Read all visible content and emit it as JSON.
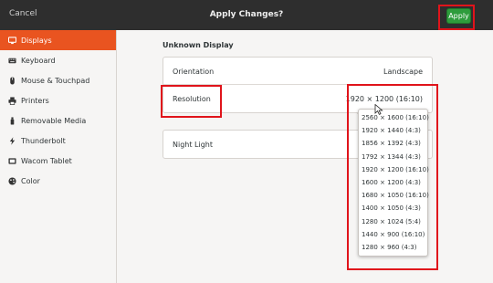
{
  "header": {
    "cancel_label": "Cancel",
    "title": "Apply Changes?",
    "apply_label": "Apply"
  },
  "sidebar": {
    "items": [
      {
        "label": "Displays",
        "icon": "display-icon",
        "active": true
      },
      {
        "label": "Keyboard",
        "icon": "keyboard-icon"
      },
      {
        "label": "Mouse & Touchpad",
        "icon": "mouse-icon"
      },
      {
        "label": "Printers",
        "icon": "printer-icon"
      },
      {
        "label": "Removable Media",
        "icon": "usb-drive-icon"
      },
      {
        "label": "Thunderbolt",
        "icon": "thunderbolt-icon"
      },
      {
        "label": "Wacom Tablet",
        "icon": "tablet-icon"
      },
      {
        "label": "Color",
        "icon": "color-palette-icon"
      }
    ]
  },
  "main": {
    "display_name": "Unknown Display",
    "orientation": {
      "label": "Orientation",
      "value": "Landscape"
    },
    "resolution": {
      "label": "Resolution",
      "value": "1920 × 1200 (16:10)"
    },
    "night_light": {
      "label": "Night Light"
    }
  },
  "resolution_options": [
    "2560 × 1600 (16:10)",
    "1920 × 1440 (4:3)",
    "1856 × 1392 (4:3)",
    "1792 × 1344 (4:3)",
    "1920 × 1200 (16:10)",
    "1600 × 1200 (4:3)",
    "1680 × 1050 (16:10)",
    "1400 × 1050 (4:3)",
    "1280 × 1024 (5:4)",
    "1440 × 900 (16:10)",
    "1280 × 960 (4:3)"
  ],
  "colors": {
    "header_bg": "#2e2e2e",
    "accent": "#e95420",
    "apply_button": "#2e9c3c",
    "highlight": "#e0141b"
  }
}
